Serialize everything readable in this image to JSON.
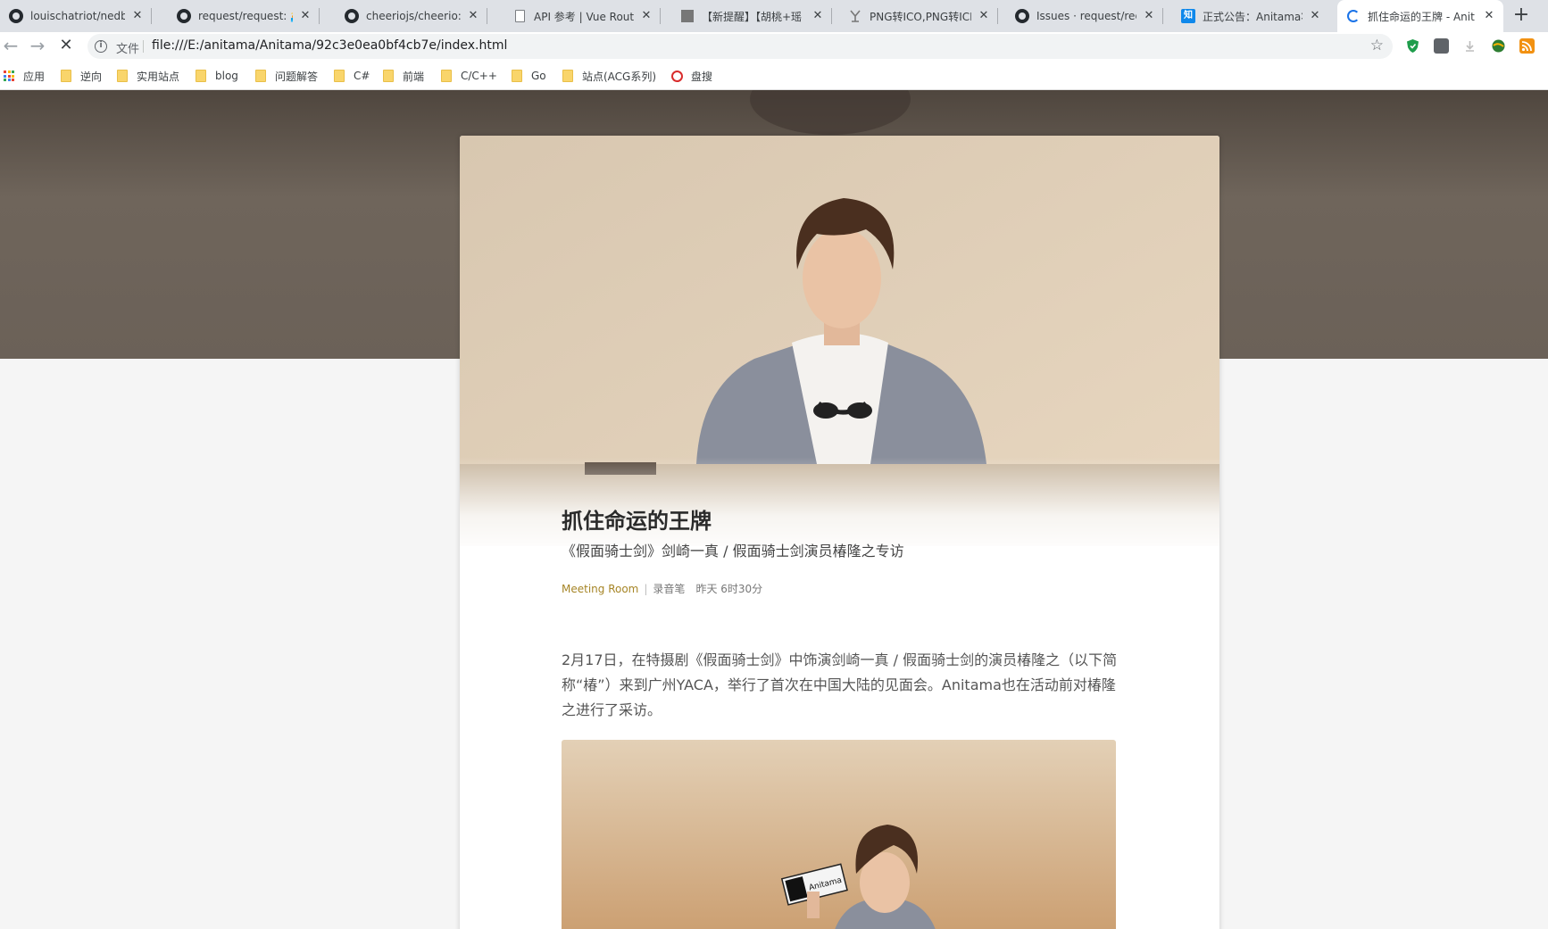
{
  "browser": {
    "tabs": [
      {
        "title": "louischatriot/nedb: Th",
        "favicon": "github-icon"
      },
      {
        "title": "request/request: 🏊 S",
        "favicon": "github-icon"
      },
      {
        "title": "cheeriojs/cheerio: Fas",
        "favicon": "github-icon"
      },
      {
        "title": "API 参考 | Vue Router",
        "favicon": "document-icon"
      },
      {
        "title": "【新提醒】【胡桃+瑶",
        "favicon": "image-icon"
      },
      {
        "title": "PNG转ICO,PNG转ICN",
        "favicon": "tool-icon"
      },
      {
        "title": "Issues · request/requ",
        "favicon": "github-icon"
      },
      {
        "title": "正式公告：Anitama将",
        "favicon": "zhihu-icon",
        "favicon_text": "知"
      },
      {
        "title": "抓住命运的王牌 - Anit",
        "favicon": "loading-spinner-icon",
        "active": true
      }
    ],
    "close_glyph": "✕",
    "new_tab_glyph": "+",
    "back_glyph": "←",
    "forward_glyph": "→",
    "stop_glyph": "✕",
    "info_glyph": "i",
    "url_scheme": "文件",
    "url": "file:///E:/anitama/Anitama/92c3e0ea0bf4cb7e/index.html",
    "bookmark_star_glyph": "☆",
    "bookmarks": [
      {
        "label": "应用",
        "icon": "apps-grid-icon"
      },
      {
        "label": "逆向",
        "icon": "folder-icon"
      },
      {
        "label": "实用站点",
        "icon": "folder-icon"
      },
      {
        "label": "blog",
        "icon": "folder-icon"
      },
      {
        "label": "问题解答",
        "icon": "folder-icon"
      },
      {
        "label": "C#",
        "icon": "folder-icon"
      },
      {
        "label": "前端",
        "icon": "folder-icon"
      },
      {
        "label": "C/C++",
        "icon": "folder-icon"
      },
      {
        "label": "Go",
        "icon": "folder-icon"
      },
      {
        "label": "站点(ACG系列)",
        "icon": "folder-icon"
      },
      {
        "label": "盘搜",
        "icon": "search-icon"
      }
    ],
    "extensions": [
      "shield-extension-icon",
      "ghost-extension-icon",
      "download-extension-icon",
      "globe-extension-icon",
      "rss-extension-icon"
    ]
  },
  "article": {
    "title": "抓住命运的王牌",
    "subtitle": "《假面骑士剑》剑崎一真 / 假面骑士剑演员椿隆之专访",
    "category": "Meeting Room",
    "separator": "|",
    "author": "录音笔",
    "time": "昨天 6时30分",
    "paragraph": "2月17日，在特摄剧《假面骑士剑》中饰演剑崎一真 / 假面骑士剑的演员椿隆之（以下简称“椿”）来到广州YACA，举行了首次在中国大陆的见面会。Anitama也在活动前对椿隆之进行了采访。",
    "sign_text": "Anitama"
  },
  "colors": {
    "tabstrip": "#dee1e6",
    "accent_category": "#a68526",
    "hero_band": "#6b6158",
    "loading_blue": "#1a73e8"
  }
}
